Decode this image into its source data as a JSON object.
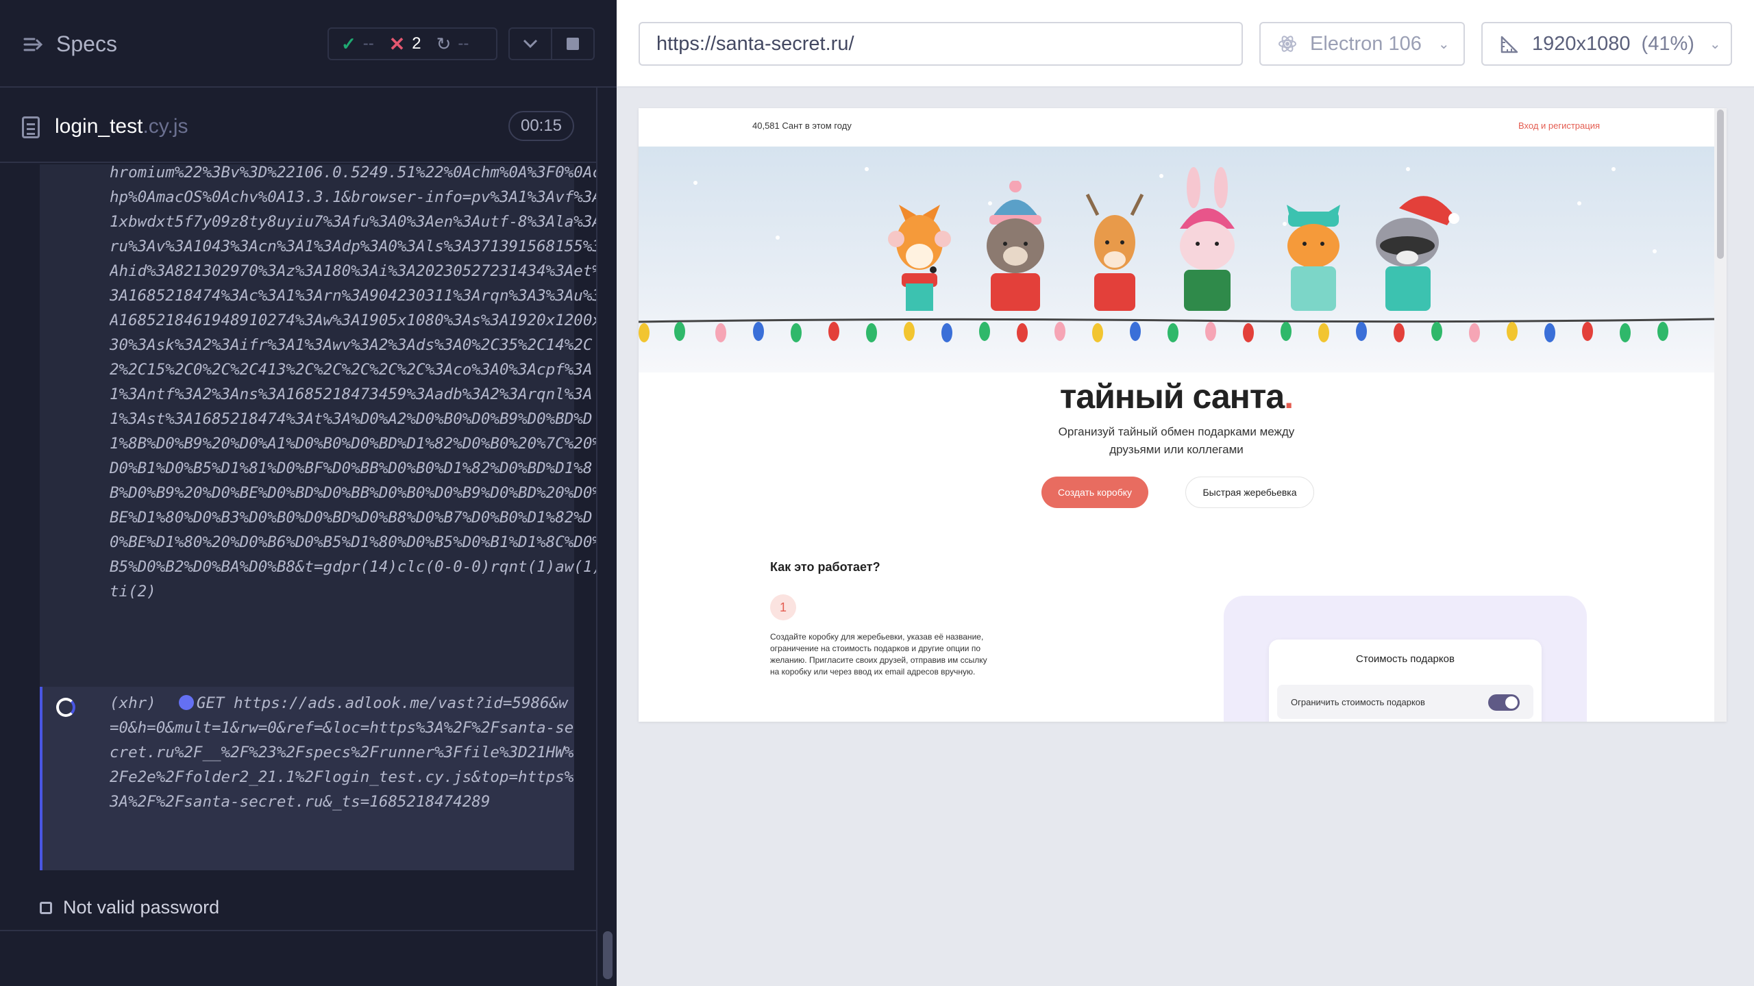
{
  "reporter": {
    "specs_label": "Specs",
    "stats": {
      "passed": "--",
      "failed": "2",
      "pending": "--"
    },
    "spec_file": {
      "name": "login_test",
      "ext": ".cy.js",
      "time": "00:15"
    },
    "log_previous": "hromium%22%3Bv%3D%22106.0.5249.51%22%0Achm%0A%3F0%0Achp%0AmacOS%0Achv%0A13.3.1&browser-info=pv%3A1%3Avf%3A1xbwdxt5f7y09z8ty8uyiu7%3Afu%3A0%3Aen%3Autf-8%3Ala%3Aru%3Av%3A1043%3Acn%3A1%3Adp%3A0%3Als%3A371391568155%3Ahid%3A821302970%3Az%3A180%3Ai%3A20230527231434%3Aet%3A1685218474%3Ac%3A1%3Arn%3A904230311%3Arqn%3A3%3Au%3A1685218461948910274%3Aw%3A1905x1080%3As%3A1920x1200x30%3Ask%3A2%3Aifr%3A1%3Awv%3A2%3Ads%3A0%2C35%2C14%2C2%2C15%2C0%2C%2C413%2C%2C%2C%2C%2C%3Aco%3A0%3Acpf%3A1%3Antf%3A2%3Ans%3A1685218473459%3Aadb%3A2%3Arqnl%3A1%3Ast%3A1685218474%3At%3A%D0%A2%D0%B0%D0%B9%D0%BD%D1%8B%D0%B9%20%D0%A1%D0%B0%D0%BD%D1%82%D0%B0%20%7C%20%D0%B1%D0%B5%D1%81%D0%BF%D0%BB%D0%B0%D1%82%D0%BD%D1%8B%D0%B9%20%D0%BE%D0%BD%D0%BB%D0%B0%D0%B9%D0%BD%20%D0%BE%D1%80%D0%B3%D0%B0%D0%BD%D0%B8%D0%B7%D0%B0%D1%82%D0%BE%D1%80%20%D0%B6%D0%B5%D1%80%D0%B5%D0%B1%D1%8C%D0%B5%D0%B2%D0%BA%D0%B8&t=gdpr(14)clc(0-0-0)rqnt(1)aw(1)ti(2)",
    "xhr": {
      "type": "(xhr)",
      "method": "GET",
      "url": "https://ads.adlook.me/vast?id=5986&w=0&h=0&mult=1&rw=0&ref=&loc=https%3A%2F%2Fsanta-secret.ru%2F__%2F%23%2Fspecs%2Frunner%3Ffile%3D21HW%2Fe2e%2Ffolder2_21.1%2Flogin_test.cy.js&top=https%3A%2F%2Fsanta-secret.ru&_ts=1685218474289"
    },
    "test_title": "Not valid password"
  },
  "aut": {
    "url": "https://santa-secret.ru/",
    "browser": "Electron 106",
    "viewport": "1920x1080",
    "viewport_scale": "(41%)"
  },
  "site": {
    "santa_count": "40,581 Сант в этом году",
    "login_link": "Вход и регистрация",
    "title": "тайный санта",
    "title_dot": ".",
    "subtitle": "Организуй тайный обмен подарками между друзьями или коллегами",
    "create_btn": "Создать коробку",
    "quick_btn": "Быстрая жеребьевка",
    "how_title": "Как это работает?",
    "step_num": "1",
    "step_text": "Создайте коробку для жеребьевки, указав её название, ограничение на стоимость подарков и другие опции по желанию. Пригласите своих друзей, отправив им ссылку на коробку или через ввод их email адресов вручную.",
    "demo_title": "Стоимость подарков",
    "demo_option": "Ограничить стоимость подарков"
  },
  "colors": {
    "accent": "#e45c50",
    "reporter_bg": "#1b1e2e",
    "pass": "#1fa971",
    "fail": "#e45770"
  }
}
